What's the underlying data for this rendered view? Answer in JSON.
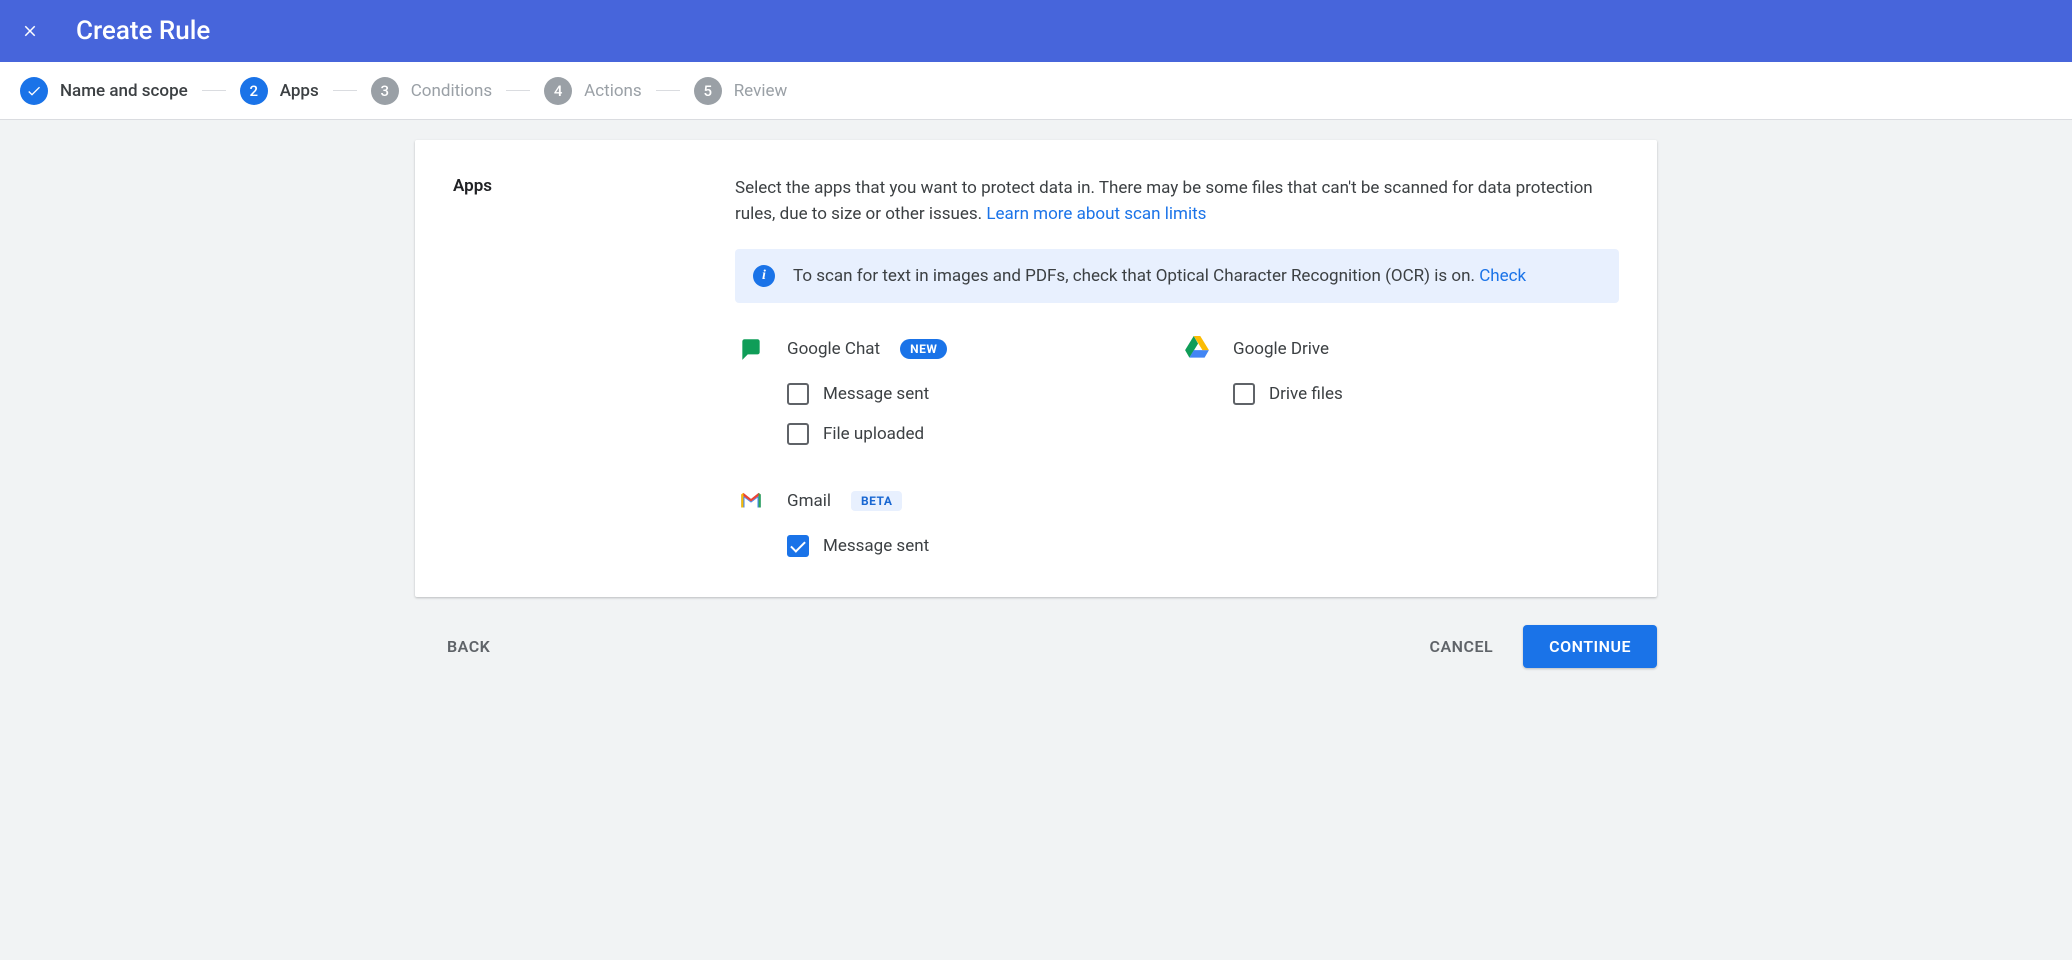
{
  "header": {
    "title": "Create Rule"
  },
  "stepper": {
    "steps": [
      {
        "num": "1",
        "label": "Name and scope",
        "state": "done"
      },
      {
        "num": "2",
        "label": "Apps",
        "state": "active"
      },
      {
        "num": "3",
        "label": "Conditions",
        "state": "pending"
      },
      {
        "num": "4",
        "label": "Actions",
        "state": "pending"
      },
      {
        "num": "5",
        "label": "Review",
        "state": "pending"
      }
    ]
  },
  "section": {
    "title": "Apps",
    "description": "Select the apps that you want to protect data in. There may be some files that can't be scanned for data protection rules, due to size or other issues. ",
    "learn_more": "Learn more about scan limits"
  },
  "infobox": {
    "text": "To scan for text in images and PDFs, check that Optical Character Recognition (OCR) is on. ",
    "link": "Check"
  },
  "apps": {
    "google_chat": {
      "name": "Google Chat",
      "badge": "NEW",
      "options": {
        "message_sent": {
          "label": "Message sent",
          "checked": false
        },
        "file_uploaded": {
          "label": "File uploaded",
          "checked": false
        }
      }
    },
    "google_drive": {
      "name": "Google Drive",
      "options": {
        "drive_files": {
          "label": "Drive files",
          "checked": false
        }
      }
    },
    "gmail": {
      "name": "Gmail",
      "badge": "BETA",
      "options": {
        "message_sent": {
          "label": "Message sent",
          "checked": true
        }
      }
    }
  },
  "footer": {
    "back": "BACK",
    "cancel": "CANCEL",
    "continue": "CONTINUE"
  }
}
